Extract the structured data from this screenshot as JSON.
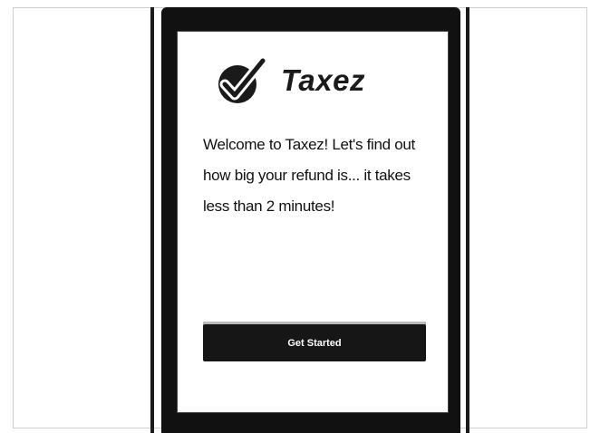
{
  "app": {
    "name": "Taxez",
    "logo_icon": "checkmark-icon"
  },
  "welcome": {
    "message": "Welcome to Taxez! Let's find out how big your refund is... it takes less than 2 minutes!"
  },
  "cta": {
    "label": "Get Started"
  },
  "colors": {
    "device": "#111111",
    "screen": "#ffffff",
    "button": "#161616",
    "text": "#111111"
  }
}
